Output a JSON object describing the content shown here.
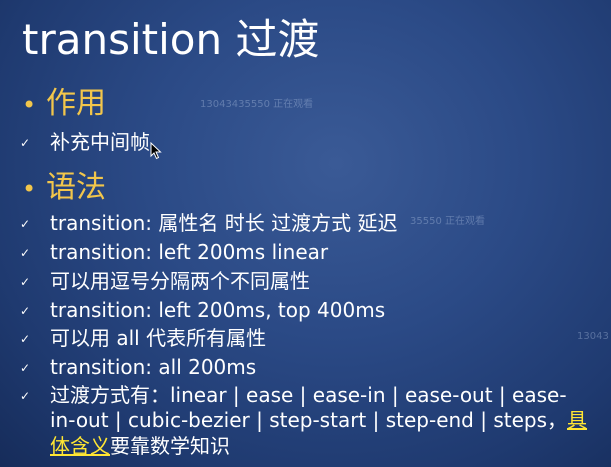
{
  "title": "transition 过渡",
  "watermarks": {
    "w1": "13043435550 正在观看",
    "w2": "35550 正在观看",
    "w3": "13043"
  },
  "section1": {
    "bullet": "•",
    "heading": "作用",
    "items": [
      {
        "check": "✓",
        "text": "补充中间帧"
      }
    ]
  },
  "section2": {
    "bullet": "•",
    "heading": "语法",
    "items": [
      {
        "check": "✓",
        "text": "transition: 属性名 时长 过渡方式 延迟"
      },
      {
        "check": "✓",
        "text": "transition: left 200ms linear"
      },
      {
        "check": "✓",
        "text": "可以用逗号分隔两个不同属性"
      },
      {
        "check": "✓",
        "text": "transition: left 200ms, top 400ms"
      },
      {
        "check": "✓",
        "text": "可以用 all 代表所有属性"
      },
      {
        "check": "✓",
        "text": "transition: all 200ms"
      }
    ],
    "last_item": {
      "check": "✓",
      "line1": "过渡方式有：linear | ease | ease-in | ease-out | ease-",
      "line2": "in-out | cubic-bezier | step-start | step-end | steps，",
      "highlight_a": "具",
      "highlight_b": "体含义",
      "line3_rest": "要靠数学知识"
    }
  },
  "colors": {
    "heading": "#f2c64b",
    "text": "#ffffff",
    "highlight": "#ffe633",
    "background": "#2b4a86"
  },
  "icons": {
    "check": "check-icon",
    "cursor": "mouse-cursor-icon"
  }
}
